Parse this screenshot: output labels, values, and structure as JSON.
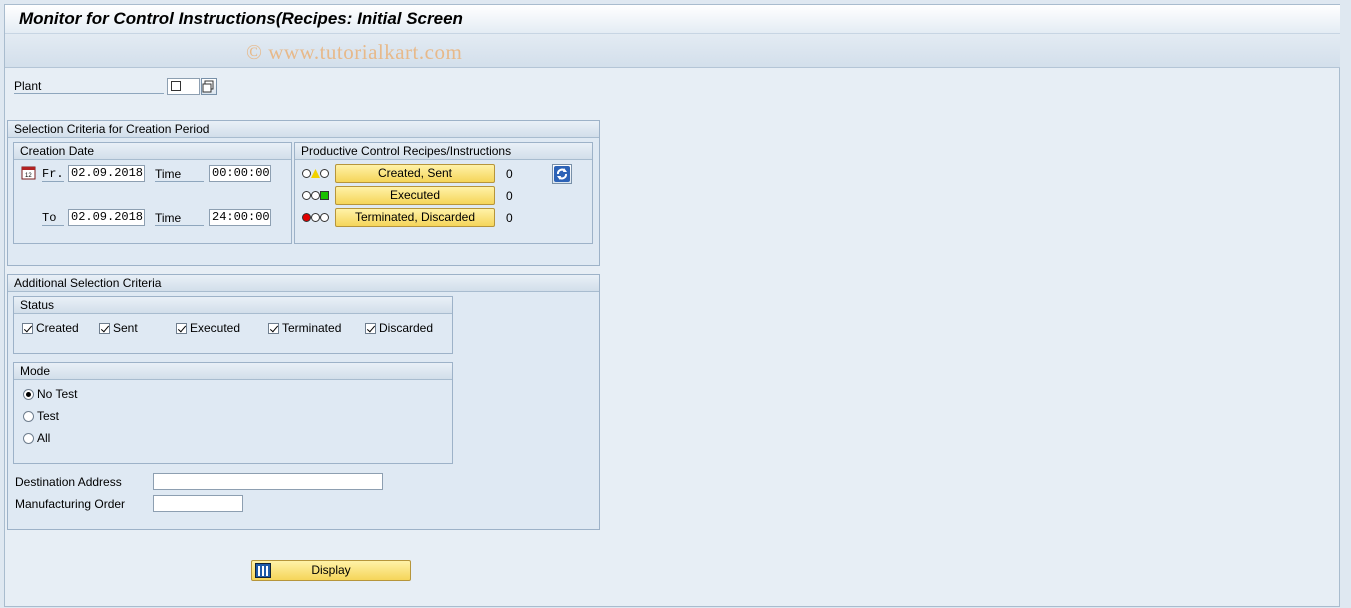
{
  "window": {
    "title": "Monitor for Control Instructions(Recipes: Initial Screen"
  },
  "watermark": "© www.tutorialkart.com",
  "plant": {
    "label": "Plant"
  },
  "creation_period": {
    "header": "Selection Criteria for Creation Period",
    "creation_date": {
      "header": "Creation Date",
      "from_label": "Fr.",
      "from_date": "02.09.2018",
      "from_time_label": "Time",
      "from_time": "00:00:00",
      "to_label": "To",
      "to_date": "02.09.2018",
      "to_time_label": "Time",
      "to_time": "24:00:00"
    },
    "productive": {
      "header": "Productive Control Recipes/Instructions",
      "rows": [
        {
          "label": "Created, Sent",
          "count": "0",
          "light": "yellow"
        },
        {
          "label": "Executed",
          "count": "0",
          "light": "green"
        },
        {
          "label": "Terminated, Discarded",
          "count": "0",
          "light": "red"
        }
      ]
    }
  },
  "additional": {
    "header": "Additional Selection Criteria",
    "status": {
      "header": "Status",
      "items": [
        "Created",
        "Sent",
        "Executed",
        "Terminated",
        "Discarded"
      ]
    },
    "mode": {
      "header": "Mode",
      "options": [
        "No Test",
        "Test",
        "All"
      ],
      "selected": "No Test"
    },
    "destination_label": "Destination Address",
    "destination_value": "",
    "order_label": "Manufacturing Order",
    "order_value": ""
  },
  "display_button": "Display",
  "colors": {
    "button": "#f5d55a",
    "light_yellow": "#f2d200",
    "light_green": "#19c000",
    "light_red": "#e00000"
  }
}
